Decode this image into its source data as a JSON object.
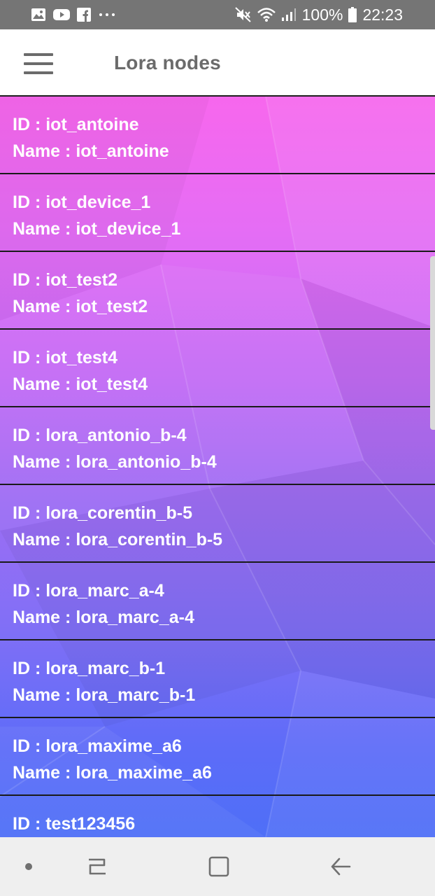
{
  "status_bar": {
    "left_icons": [
      "image-icon",
      "youtube-icon",
      "facebook-icon",
      "more-dots-icon"
    ],
    "right_icons": [
      "mute-icon",
      "wifi-icon",
      "signal-icon"
    ],
    "battery": "100%",
    "time": "22:23"
  },
  "app_bar": {
    "title": "Lora nodes",
    "menu_icon": "hamburger-menu-icon"
  },
  "list": {
    "id_prefix": "ID : ",
    "name_prefix": "Name : ",
    "nodes": [
      {
        "id": "iot_antoine",
        "name": "iot_antoine"
      },
      {
        "id": "iot_device_1",
        "name": "iot_device_1"
      },
      {
        "id": "iot_test2",
        "name": "iot_test2"
      },
      {
        "id": "iot_test4",
        "name": "iot_test4"
      },
      {
        "id": "lora_antonio_b-4",
        "name": "lora_antonio_b-4"
      },
      {
        "id": "lora_corentin_b-5",
        "name": "lora_corentin_b-5"
      },
      {
        "id": "lora_marc_a-4",
        "name": "lora_marc_a-4"
      },
      {
        "id": "lora_marc_b-1",
        "name": "lora_marc_b-1"
      },
      {
        "id": "lora_maxime_a6",
        "name": "lora_maxime_a6"
      },
      {
        "id": "test123456",
        "name": ""
      }
    ]
  },
  "nav_bar": {
    "buttons": [
      "dot-icon",
      "recents-icon",
      "home-icon",
      "back-icon"
    ]
  },
  "colors": {
    "status_bar": "#757575",
    "app_bar": "#ffffff",
    "title_text": "#6b6b6b",
    "gradient_top": "#f767ed",
    "gradient_bottom": "#4e6ff7",
    "divider": "#1a1a1a",
    "nav_bar": "#efefef"
  }
}
